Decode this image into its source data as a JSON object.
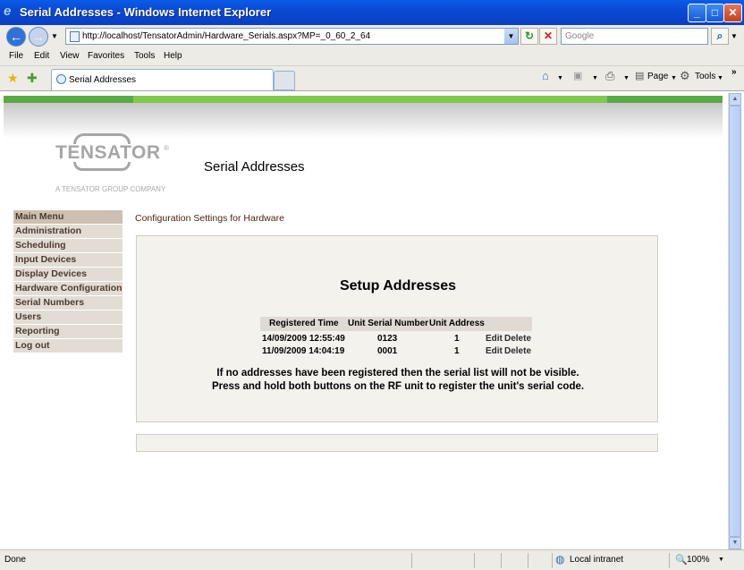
{
  "window": {
    "title": "Serial Addresses - Windows Internet Explorer"
  },
  "nav": {
    "url": "http://localhost/TensatorAdmin/Hardware_Serials.aspx?MP=_0_60_2_64",
    "search_placeholder": "Google"
  },
  "menu": [
    "File",
    "Edit",
    "View",
    "Favorites",
    "Tools",
    "Help"
  ],
  "tab": {
    "label": "Serial Addresses"
  },
  "toolbar": {
    "page_label": "Page",
    "tools_label": "Tools"
  },
  "page": {
    "logo_text": "TENSATOR",
    "logo_reg": "®",
    "logo_sub": "A TENSATOR GROUP COMPANY",
    "title": "Serial Addresses",
    "subheading": "Configuration Settings for Hardware",
    "panel_heading": "Setup Addresses"
  },
  "sidebar": {
    "items": [
      {
        "label": "Main Menu"
      },
      {
        "label": "Administration"
      },
      {
        "label": "Scheduling"
      },
      {
        "label": "Input Devices"
      },
      {
        "label": "Display Devices"
      },
      {
        "label": "Hardware Configuration"
      },
      {
        "label": "Serial Numbers"
      },
      {
        "label": "Users"
      },
      {
        "label": "Reporting"
      },
      {
        "label": "Log out"
      }
    ]
  },
  "table": {
    "headers": [
      "Registered Time",
      "Unit Serial Number",
      "Unit Address"
    ],
    "rows": [
      {
        "time": "14/09/2009 12:55:49",
        "serial": "0123",
        "address": "1",
        "edit": "Edit",
        "delete": "Delete"
      },
      {
        "time": "11/09/2009 14:04:19",
        "serial": "0001",
        "address": "1",
        "edit": "Edit",
        "delete": "Delete"
      }
    ]
  },
  "notes": {
    "line1": "If no addresses have been registered then the serial list will not be visible.",
    "line2": "Press and hold both buttons on the RF unit to register the unit's serial code."
  },
  "status": {
    "left": "Done",
    "zone": "Local intranet",
    "zoom": "100%"
  },
  "colors": {
    "green_bar": "#5aaa48",
    "menu_bg": "#e3dcd4",
    "titlebar": "#0b49d4"
  }
}
